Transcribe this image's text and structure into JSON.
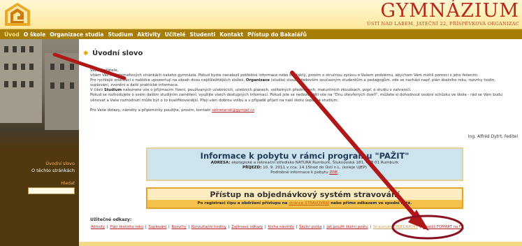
{
  "header": {
    "site_title": "GYMNÁZIUM",
    "site_subtitle": "ÚSTÍ NAD LABEM, JATEČNÍ 22, PŘÍSPĚVKOVÁ ORGANIZAC"
  },
  "nav": {
    "items": [
      "Úvod",
      "O škole",
      "Organizace studia",
      "Studium",
      "Aktivity",
      "Učitelé",
      "Studenti",
      "Kontakt",
      "Přístup do Bakalářů"
    ]
  },
  "sidebar": {
    "links": [
      "Úvodní slovo",
      "O těchto stránkách"
    ],
    "search_label": "Hledat",
    "search_value": ""
  },
  "main": {
    "section_title": "Úvodní slovo",
    "greeting": "Vážení přátelé,",
    "p1": "vítám Vás na internetových stránkách našeho gymnázia. Pokud byste nenalezli potřebné informace nebo kontakty, prosím o stručnou zprávu o Vašem problému, abychom Vám mohli pomoci s jeho řešením.",
    "p2_a": "Pro rychlejší orientaci v nabídce upozorňuji na obsah dvou nejdůležitějších složek. ",
    "p2_bold": "Organizace",
    "p2_b": " (studia) slouží především současným studentům a pedagogům, zde se nachází např. plán školního roku, rozvrhy hodin, suplování, zvonění a další praktické informace.",
    "p3_a": "V části ",
    "p3_bold": "Studium",
    "p3_b": " naleznete vše o přijímacím řízení, používaných učebnicích, učebních plánech, volitelných předmětech, maturitních zkouškách, popř. o studiu v zahraničí.",
    "p4": "Pokud se rozhodujete o svém dalším studijním zaměření, využijte všech dostupných informací. Pokud jste se nedozvěděli vše na \"Dnu otevřených dveří\", můžete si dohodnout osobní schůzku ve škole - rád se Vám budu věnovat a Vaše rozhodnutí může být o to kvalifikovanější. Přeji vám dobrou volbu a v případě přijetí na naší školu úspěšné studium.",
    "p5_a": "Pro Vaše dotazy, náměty a připomínky použijte, prosím, kontakt ",
    "p5_link": "sekretariat@gymjat.cz",
    "p5_b": ".",
    "signature": "Ing. Alfréd Dytrt, ředitel"
  },
  "pazit": {
    "title": "Informace k pobytu v rámci programu \"PAŽIT\"",
    "line1_bold": "ADRESA:",
    "line1": " ekologické a rekreační středisko NATURA Rumburk, Šluknovská 181, 408 01 Rumburk",
    "line2_bold": "PŘÍJEZD:",
    "line2": " 10. 9. 2011 v cca. 14.15hod do Ústí n.L. (koleje UJEP)",
    "line3_a": "Podrobné informace k pobytu ",
    "line3_link": "ZDE",
    "line3_b": "."
  },
  "food": {
    "title": "Přístup na objednávkový systém stravování",
    "strip_a": "Po registraci čipu a obdržení přístupu na ",
    "strip_link": "stránce STRAVOVÁNÍ",
    "strip_b": " nebo přímo odkazem ve spodní liště."
  },
  "useful": {
    "label": "Užitečné odkazy:",
    "links": [
      "Aktivity",
      "Plán školního roku",
      "Suplování",
      "Rozvrhy",
      "Konzultační hodiny",
      "Zajímavé odkazy",
      "Kniha návštěv",
      "Školní pošta",
      "Jak použít školní poštu",
      "Stravování OBJEDNÁVKY",
      "Soutěž FOMART na FB"
    ]
  },
  "colors": {
    "nav_bg": "#a77d0a",
    "sidebar_bg": "#50380f",
    "accent_red": "#b32a1c",
    "annotation_red": "#b01818"
  },
  "icons": {
    "logo": "school-logo",
    "title_bullet": "star-icon"
  }
}
